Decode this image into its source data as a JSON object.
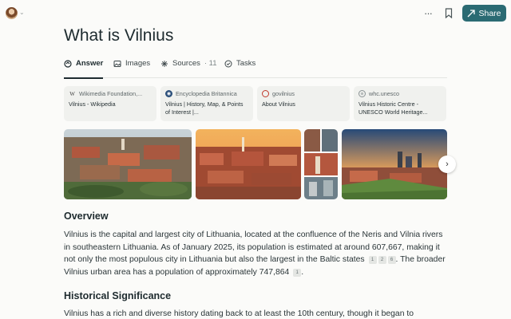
{
  "header": {
    "share_label": "Share"
  },
  "page": {
    "title": "What is Vilnius"
  },
  "tabs": [
    {
      "label": "Answer"
    },
    {
      "label": "Images"
    },
    {
      "label": "Sources",
      "count": "11"
    },
    {
      "label": "Tasks"
    }
  ],
  "sources": [
    {
      "site": "Wikimedia Foundation,...",
      "title": "Vilnius - Wikipedia",
      "icon": "W"
    },
    {
      "site": "Encyclopedia Britannica",
      "title": "Vilnius | History, Map, & Points of Interest |...",
      "icon": "globe"
    },
    {
      "site": "govilnius",
      "title": "About Vilnius",
      "icon": "circle"
    },
    {
      "site": "whc.unesco",
      "title": "Vilnius Historic Centre - UNESCO World Heritage...",
      "icon": "globe"
    }
  ],
  "overview": {
    "heading": "Overview",
    "text_1": "Vilnius is the capital and largest city of Lithuania, located at the confluence of the Neris and Vilnia rivers in southeastern Lithuania. As of January 2025, its population is estimated at around 607,667, making it not only the most populous city in Lithuania but also the largest in the Baltic states",
    "cites_1": [
      "1",
      "2",
      "6"
    ],
    "text_2": ". The broader Vilnius urban area has a population of approximately 747,864",
    "cites_2": [
      "1"
    ],
    "text_3": "."
  },
  "history": {
    "heading": "Historical Significance",
    "text": "Vilnius has a rich and diverse history dating back to at least the 10th century, though it began to"
  },
  "colors": {
    "accent": "#2b6b73",
    "text": "#1e2b2f"
  }
}
